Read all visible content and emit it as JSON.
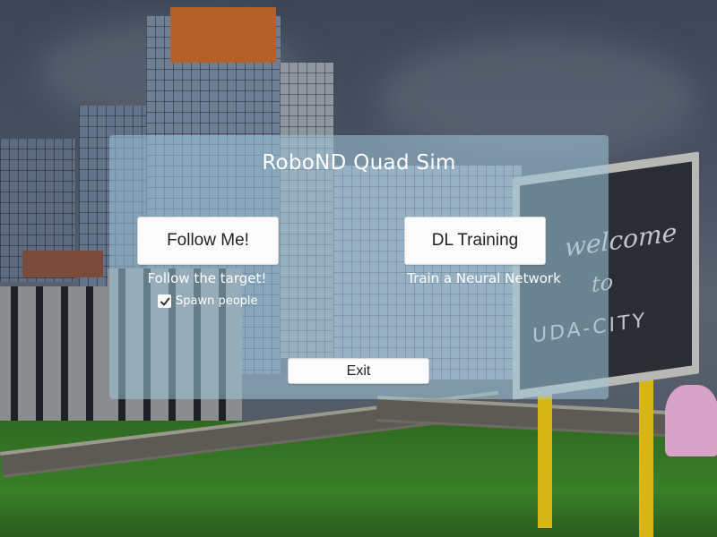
{
  "scene": {
    "description_icon": "city-background"
  },
  "menu": {
    "title": "RoboND Quad Sim",
    "follow_button": "Follow Me!",
    "follow_caption": "Follow the target!",
    "spawn_label": "Spawn people",
    "spawn_checked": true,
    "dl_button": "DL Training",
    "dl_caption": "Train a Neural Network",
    "exit_button": "Exit"
  },
  "billboard": {
    "line1": "welcome",
    "line2": "to",
    "brand": "UDA-CITY"
  },
  "colors": {
    "panel": "#a0c8dc",
    "button": "#fbfbfb",
    "sign_pole": "#d8b516"
  }
}
